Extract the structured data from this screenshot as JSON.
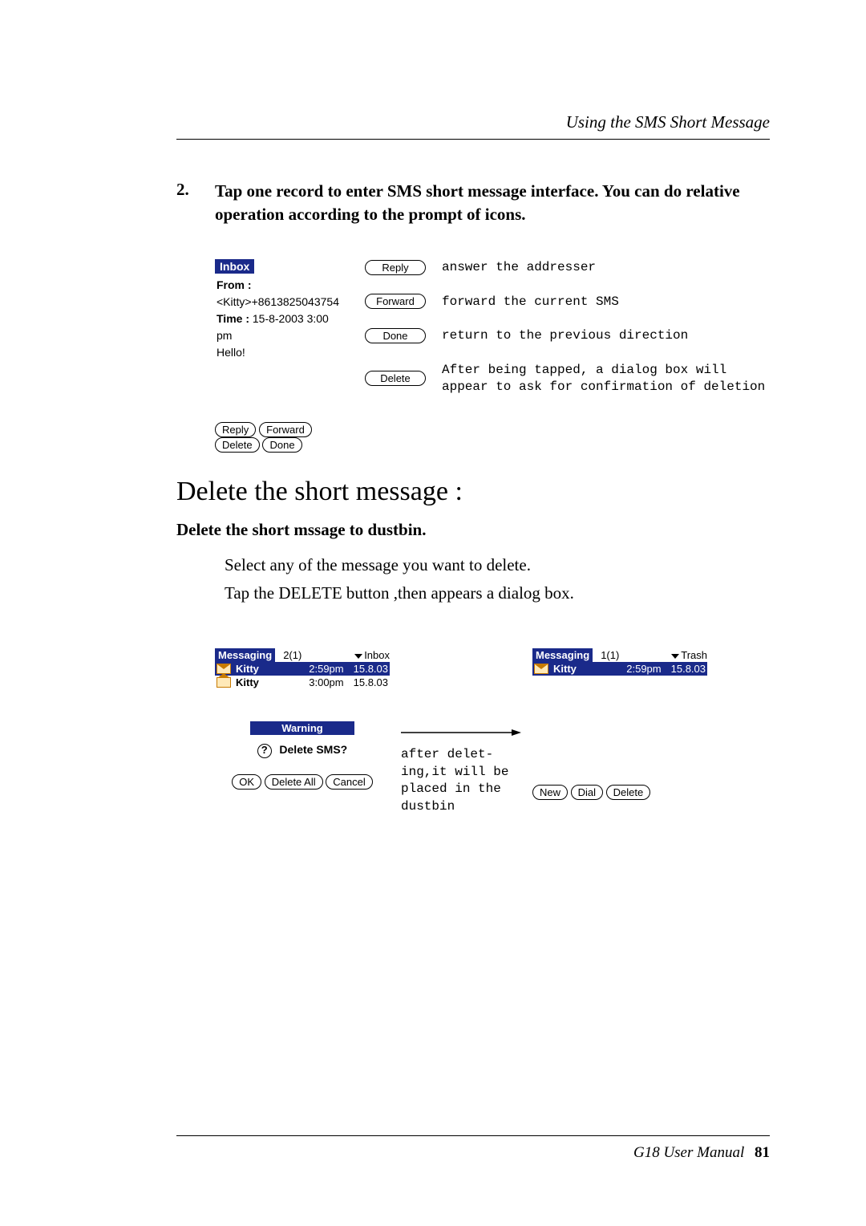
{
  "header": {
    "title": "Using the SMS Short Message"
  },
  "step": {
    "number": "2.",
    "text": "Tap one record to enter SMS short message interface. You can do relative operation according to the prompt of icons."
  },
  "inbox": {
    "title": "Inbox",
    "from_label": "From :",
    "from_value": "<Kitty>+8613825043754",
    "time_label": "Time :",
    "time_value": "15-8-2003  3:00 pm",
    "body": "Hello!",
    "buttons": {
      "reply": "Reply",
      "forward": "Forward",
      "delete": "Delete",
      "done": "Done"
    }
  },
  "legend": {
    "reply": {
      "label": "Reply",
      "desc": "answer the addresser"
    },
    "forward": {
      "label": "Forward",
      "desc": "forward the current SMS"
    },
    "done": {
      "label": "Done",
      "desc": "return to the previous direction"
    },
    "delete": {
      "label": "Delete",
      "desc": "After being tapped, a dialog box will appear to ask for confirmation of deletion"
    }
  },
  "section": {
    "title": "Delete the short message :",
    "subtitle": "Delete the short mssage to dustbin.",
    "line1": "Select any of the message you want to delete.",
    "line2": "Tap the DELETE button ,then appears a dialog box."
  },
  "fig_left": {
    "chip": "Messaging",
    "count": "2(1)",
    "folder": "Inbox",
    "rows": [
      {
        "name": "Kitty",
        "time": "2:59pm",
        "date": "15.8.03",
        "selected": true,
        "closed": true
      },
      {
        "name": "Kitty",
        "time": "3:00pm",
        "date": "15.8.03",
        "selected": false,
        "closed": false
      }
    ],
    "warning_title": "Warning",
    "warning_q": "Delete SMS?",
    "ok": "OK",
    "delete_all": "Delete All",
    "cancel": "Cancel"
  },
  "mid": {
    "text": "after delet-ing,it will be placed in the dustbin"
  },
  "fig_right": {
    "chip": "Messaging",
    "count": "1(1)",
    "folder": "Trash",
    "rows": [
      {
        "name": "Kitty",
        "time": "2:59pm",
        "date": "15.8.03",
        "selected": true,
        "closed": true
      }
    ],
    "new": "New",
    "dial": "Dial",
    "delete": "Delete"
  },
  "footer": {
    "manual": "G18 User Manual",
    "page": "81"
  }
}
